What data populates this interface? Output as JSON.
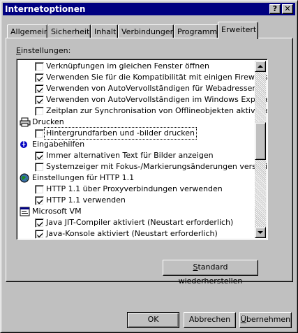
{
  "window": {
    "title": "Internetoptionen"
  },
  "titlebar": {
    "help": "?",
    "close": "✕"
  },
  "tabs": [
    {
      "label": "Allgemein"
    },
    {
      "label": "Sicherheit"
    },
    {
      "label": "Inhalt"
    },
    {
      "label": "Verbindungen"
    },
    {
      "label": "Programme"
    },
    {
      "label": "Erweitert",
      "active": true
    }
  ],
  "settings": {
    "label_prefix": "E",
    "label_rest": "instellungen:",
    "rows": [
      {
        "type": "check",
        "checked": false,
        "label": "Verknüpfungen im gleichen Fenster öffnen"
      },
      {
        "type": "check",
        "checked": true,
        "label": "Verwenden Sie für die Kompatibilität mit einigen Firewalls und D"
      },
      {
        "type": "check",
        "checked": true,
        "label": "Verwenden von AutoVervollständigen für Webadressen"
      },
      {
        "type": "check",
        "checked": true,
        "label": "Verwenden von AutoVervollständigen im Windows Explorer"
      },
      {
        "type": "check",
        "checked": false,
        "label": "Zeitplan zur Synchronisation von Offlineobjekten aktivieren"
      },
      {
        "type": "category",
        "icon": "printer-icon",
        "label": "Drucken"
      },
      {
        "type": "check",
        "checked": false,
        "focused": true,
        "label": "Hintergrundfarben und -bilder drucken"
      },
      {
        "type": "category",
        "icon": "accessibility-icon",
        "label": "Eingabehilfen"
      },
      {
        "type": "check",
        "checked": true,
        "label": "Immer alternativen Text für Bilder anzeigen"
      },
      {
        "type": "check",
        "checked": false,
        "label": "Systemzeiger mit Fokus-/Markierungsänderungen verschieben"
      },
      {
        "type": "category",
        "icon": "globe-icon",
        "label": "Einstellungen für HTTP 1.1"
      },
      {
        "type": "check",
        "checked": false,
        "label": "HTTP 1.1 über Proxyverbindungen verwenden"
      },
      {
        "type": "check",
        "checked": true,
        "label": "HTTP 1.1 verwenden"
      },
      {
        "type": "category",
        "icon": "java-vm-icon",
        "label": "Microsoft VM"
      },
      {
        "type": "check",
        "checked": true,
        "label": "Java JIT-Compiler aktiviert (Neustart erforderlich)"
      },
      {
        "type": "check",
        "checked": true,
        "label": "Java-Konsole aktiviert (Neustart erforderlich)"
      }
    ]
  },
  "buttons": {
    "restore_ul": "S",
    "restore_rest": "tandard wiederherstellen",
    "ok": "OK",
    "cancel": "Abbrechen",
    "apply_ul": "Ü",
    "apply_rest": "bernehmen"
  },
  "colors": {
    "titlebar": "#000080",
    "face": "#c0c0c0"
  }
}
